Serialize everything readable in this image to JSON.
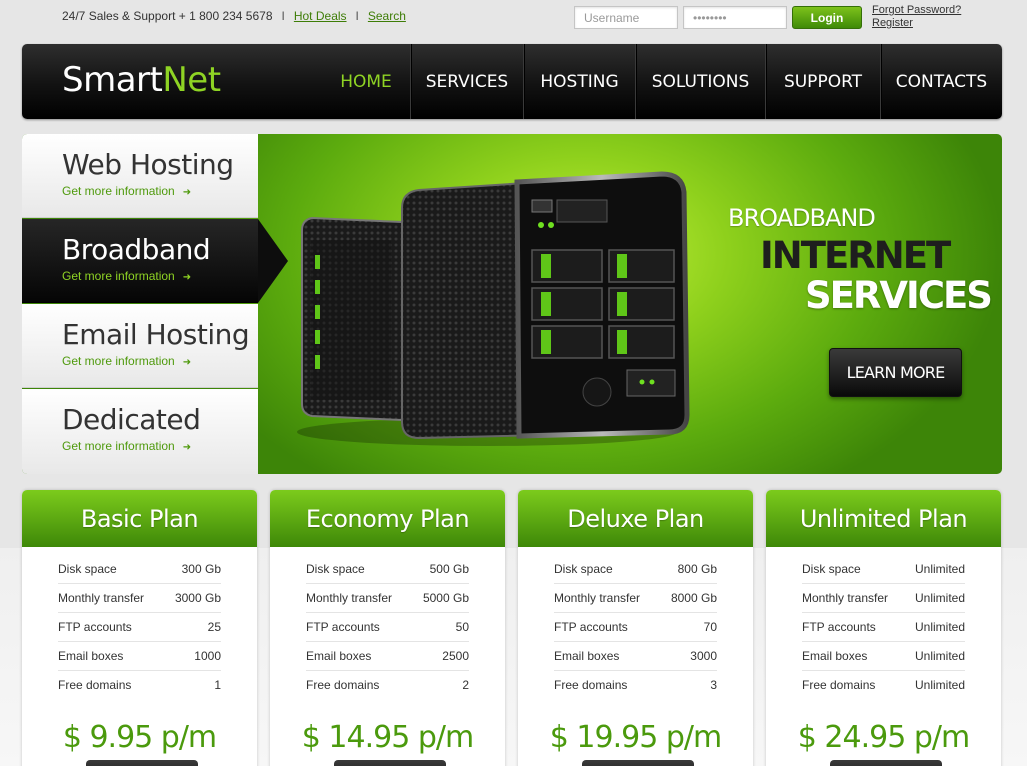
{
  "topbar": {
    "support_text": "24/7 Sales & Support + 1 800 234 5678",
    "separator": "I",
    "hot_deals": "Hot Deals",
    "search": "Search",
    "username_placeholder": "Username",
    "password_value": "••••••••",
    "login_label": "Login",
    "forgot_password": "Forgot Password?",
    "register": "Register"
  },
  "header": {
    "logo_part1": "Smart",
    "logo_part2": "Net",
    "nav": [
      "HOME",
      "SERVICES",
      "HOSTING",
      "SOLUTIONS",
      "SUPPORT",
      "CONTACTS"
    ],
    "active_nav": "HOME"
  },
  "hero": {
    "tabs": [
      {
        "title": "Web Hosting",
        "link": "Get more information"
      },
      {
        "title": "Broadband",
        "link": "Get more information"
      },
      {
        "title": "Email Hosting",
        "link": "Get more information"
      },
      {
        "title": "Dedicated",
        "link": "Get more information"
      }
    ],
    "active_tab": "Broadband",
    "line1": "BROADBAND",
    "line2": "INTERNET",
    "line3": "SERVICES",
    "button": "LEARN MORE"
  },
  "plans": [
    {
      "name": "Basic Plan",
      "price": "$ 9.95 p/m",
      "rows": [
        [
          "Disk space",
          "300 Gb"
        ],
        [
          "Monthly transfer",
          "3000 Gb"
        ],
        [
          "FTP accounts",
          "25"
        ],
        [
          "Email boxes",
          "1000"
        ],
        [
          "Free domains",
          "1"
        ]
      ]
    },
    {
      "name": "Economy Plan",
      "price": "$ 14.95 p/m",
      "rows": [
        [
          "Disk space",
          "500 Gb"
        ],
        [
          "Monthly transfer",
          "5000 Gb"
        ],
        [
          "FTP accounts",
          "50"
        ],
        [
          "Email boxes",
          "2500"
        ],
        [
          "Free domains",
          "2"
        ]
      ]
    },
    {
      "name": "Deluxe Plan",
      "price": "$ 19.95 p/m",
      "rows": [
        [
          "Disk space",
          "800 Gb"
        ],
        [
          "Monthly transfer",
          "8000 Gb"
        ],
        [
          "FTP accounts",
          "70"
        ],
        [
          "Email boxes",
          "3000"
        ],
        [
          "Free domains",
          "3"
        ]
      ]
    },
    {
      "name": "Unlimited Plan",
      "price": "$ 24.95 p/m",
      "rows": [
        [
          "Disk space",
          "Unlimited"
        ],
        [
          "Monthly transfer",
          "Unlimited"
        ],
        [
          "FTP accounts",
          "Unlimited"
        ],
        [
          "Email boxes",
          "Unlimited"
        ],
        [
          "Free domains",
          "Unlimited"
        ]
      ]
    }
  ],
  "colors": {
    "accent": "#8fd424",
    "accent_dark": "#3e8808",
    "header_bg": "#000000"
  }
}
